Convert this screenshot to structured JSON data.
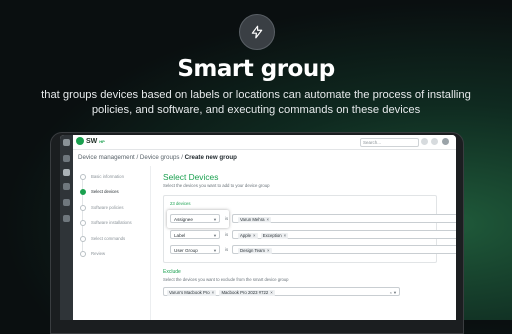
{
  "hero": {
    "icon": "lightning-bolt-icon",
    "title": "Smart group",
    "subtitle": "that groups devices based on labels or locations can automate the process of installing policies, and software, and executing commands on these devices"
  },
  "app": {
    "logo_text": "SW",
    "logo_suffix": "HP",
    "search_placeholder": "Search...",
    "breadcrumb": {
      "part1": "Device management",
      "sep": " / ",
      "part2": "Device groups",
      "part3": "Create new group"
    },
    "steps": [
      {
        "label": "Basic information",
        "active": false
      },
      {
        "label": "Select devices",
        "active": true
      },
      {
        "label": "Software policies",
        "active": false
      },
      {
        "label": "Software installations",
        "active": false
      },
      {
        "label": "Select commands",
        "active": false
      },
      {
        "label": "Review",
        "active": false
      }
    ],
    "select": {
      "title": "Select Devices",
      "description": "Select the devices you want to add to your device group",
      "count": "23 devices",
      "is_label": "is",
      "conditions": [
        {
          "field": "Assignee",
          "values": [
            "Varun Mehra"
          ]
        },
        {
          "field": "Label",
          "values": [
            "Apple",
            "Exception"
          ]
        },
        {
          "field": "User Group",
          "values": [
            "Design Team"
          ]
        }
      ]
    },
    "exclude": {
      "title": "Exclude",
      "description": "Select the devices you want to exclude from the smart device group",
      "chips": [
        "Varun's Macbook Pro",
        "Macbook Pro 2023 #722"
      ]
    }
  },
  "colors": {
    "accent": "#1aa04f"
  }
}
